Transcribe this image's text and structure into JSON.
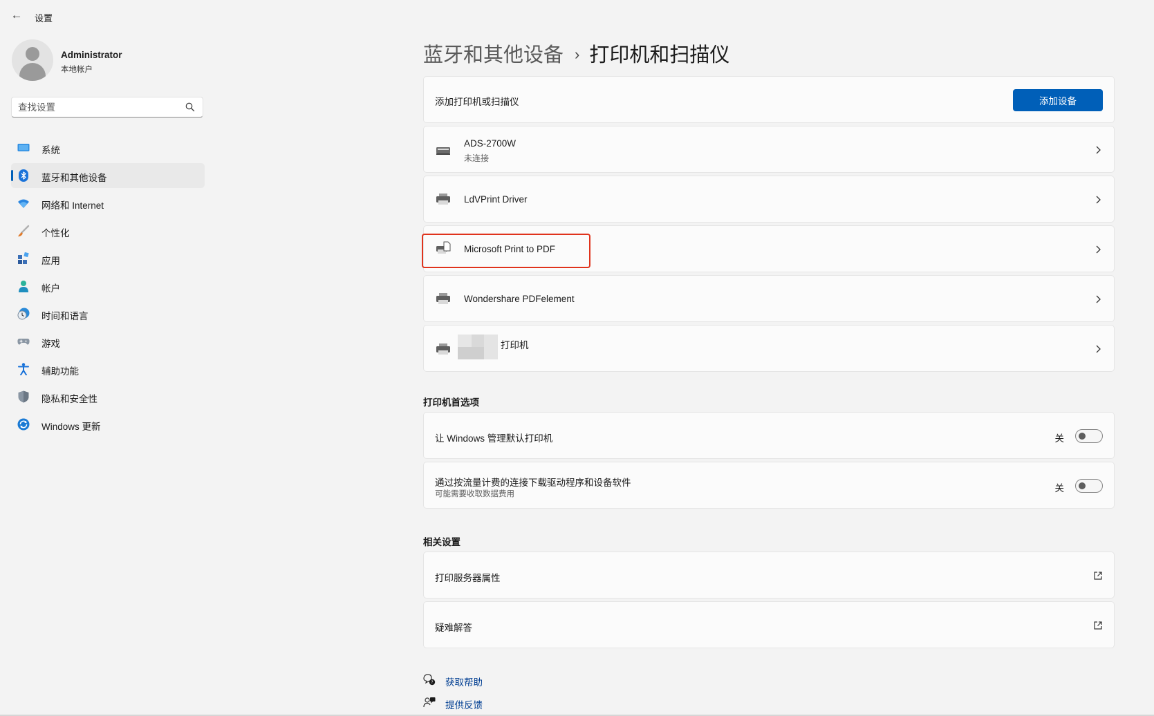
{
  "window": {
    "title": "设置"
  },
  "profile": {
    "name": "Administrator",
    "account_type": "本地帐户"
  },
  "search": {
    "placeholder": "查找设置"
  },
  "sidebar": {
    "items": [
      {
        "label": "系统",
        "icon": "monitor-icon"
      },
      {
        "label": "蓝牙和其他设备",
        "icon": "bluetooth-icon",
        "active": true
      },
      {
        "label": "网络和 Internet",
        "icon": "wifi-icon"
      },
      {
        "label": "个性化",
        "icon": "brush-icon"
      },
      {
        "label": "应用",
        "icon": "apps-icon"
      },
      {
        "label": "帐户",
        "icon": "person-icon"
      },
      {
        "label": "时间和语言",
        "icon": "globe-clock-icon"
      },
      {
        "label": "游戏",
        "icon": "gamepad-icon"
      },
      {
        "label": "辅助功能",
        "icon": "accessibility-icon"
      },
      {
        "label": "隐私和安全性",
        "icon": "shield-icon"
      },
      {
        "label": "Windows 更新",
        "icon": "update-icon"
      }
    ]
  },
  "breadcrumb": {
    "parent": "蓝牙和其他设备",
    "separator": "›",
    "current": "打印机和扫描仪"
  },
  "add_printer": {
    "label": "添加打印机或扫描仪",
    "button_label": "添加设备"
  },
  "devices": [
    {
      "name": "ADS-2700W",
      "status": "未连接",
      "icon": "scanner-icon"
    },
    {
      "name": "LdVPrint Driver",
      "status": "",
      "icon": "printer-icon"
    },
    {
      "name": "Microsoft Print to PDF",
      "status": "",
      "icon": "printer-pdf-icon",
      "highlighted": true
    },
    {
      "name": "Wondershare PDFelement",
      "status": "",
      "icon": "printer-icon"
    },
    {
      "name": "打印机",
      "status": "",
      "icon": "printer-icon",
      "partially_redacted": true
    }
  ],
  "preferences": {
    "title": "打印机首选项",
    "items": [
      {
        "label": "让 Windows 管理默认打印机",
        "sublabel": "",
        "state_label": "关",
        "on": false
      },
      {
        "label": "通过按流量计费的连接下载驱动程序和设备软件",
        "sublabel": "可能需要收取数据费用",
        "state_label": "关",
        "on": false
      }
    ]
  },
  "related": {
    "title": "相关设置",
    "items": [
      {
        "label": "打印服务器属性",
        "icon": "external-link-icon"
      },
      {
        "label": "疑难解答",
        "icon": "external-link-icon"
      }
    ]
  },
  "help": {
    "get_help": "获取帮助",
    "feedback": "提供反馈"
  },
  "colors": {
    "accent": "#005fb8",
    "highlight_box": "#e0331c",
    "link": "#003e92"
  }
}
